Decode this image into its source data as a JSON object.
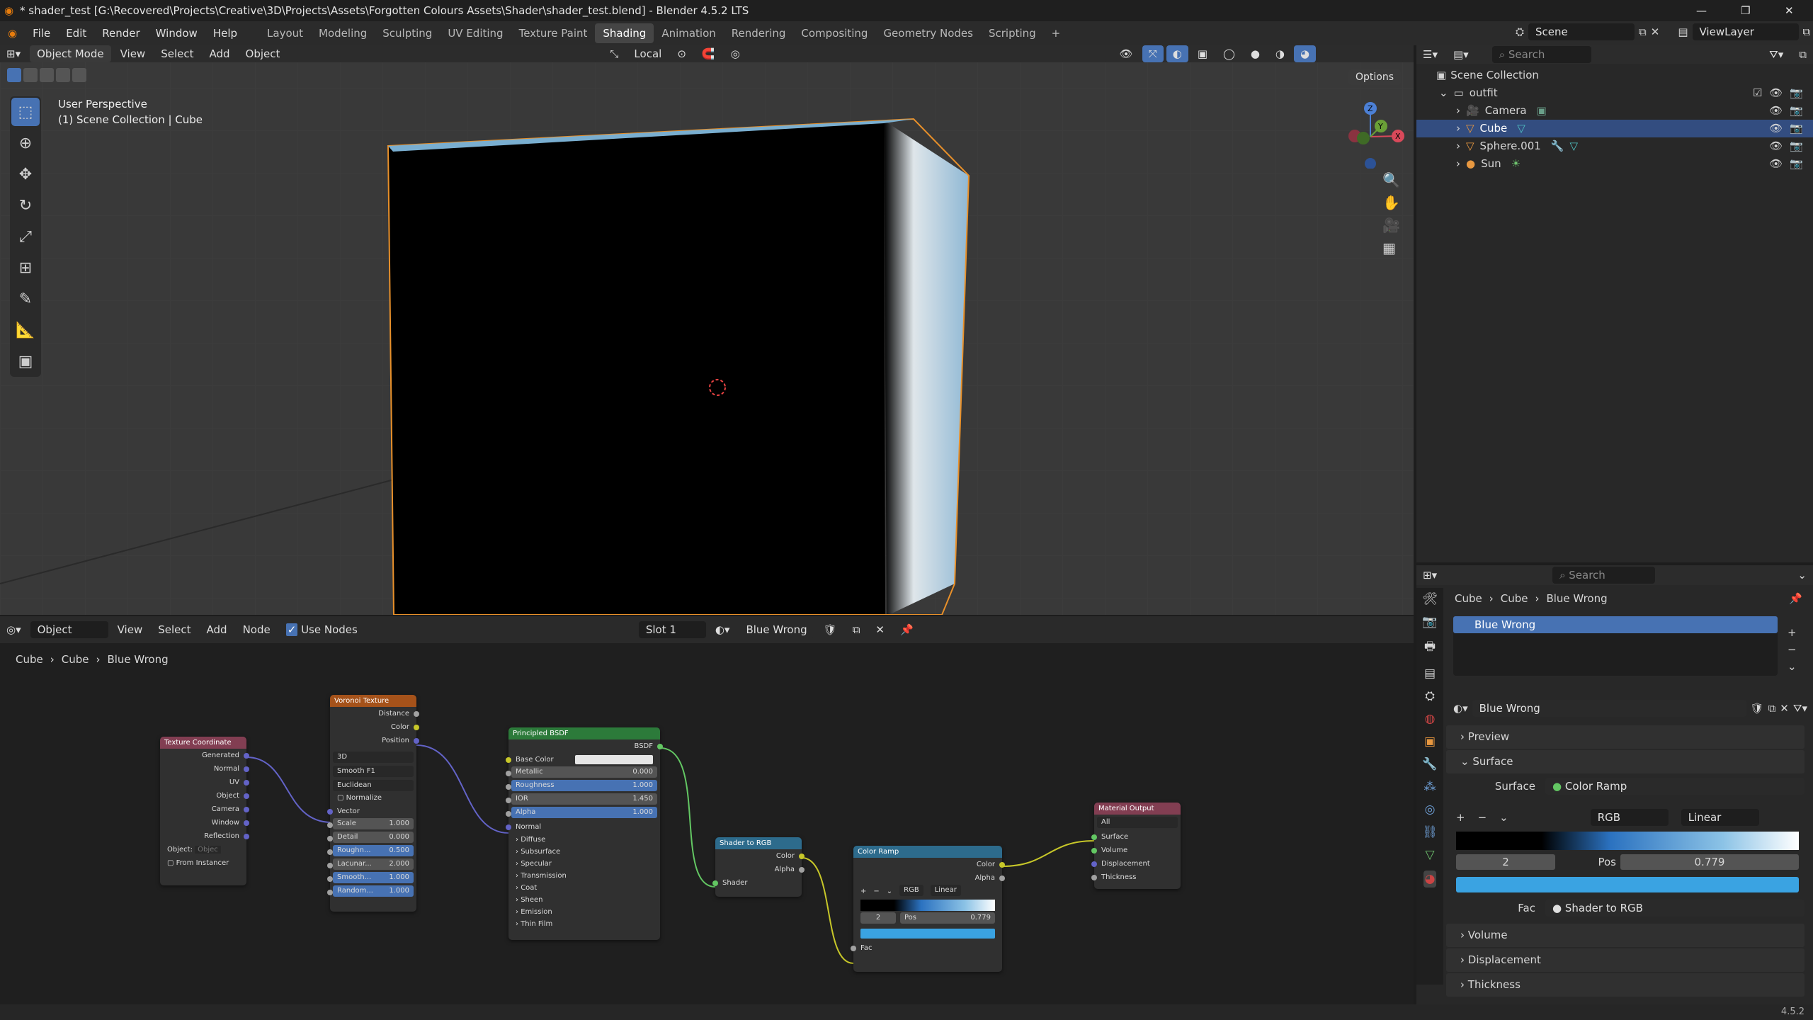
{
  "window": {
    "title": "* shader_test [G:\\Recovered\\Projects\\Creative\\3D\\Projects\\Assets\\Forgotten Colours Assets\\Shader\\shader_test.blend] - Blender 4.5.2 LTS"
  },
  "menu": {
    "items": [
      "File",
      "Edit",
      "Render",
      "Window",
      "Help"
    ]
  },
  "workspaces": [
    "Layout",
    "Modeling",
    "Sculpting",
    "UV Editing",
    "Texture Paint",
    "Shading",
    "Animation",
    "Rendering",
    "Compositing",
    "Geometry Nodes",
    "Scripting"
  ],
  "active_workspace": "Shading",
  "scene": {
    "name": "Scene",
    "view_layer": "ViewLayer"
  },
  "viewport": {
    "mode": "Object Mode",
    "menus": [
      "View",
      "Select",
      "Add",
      "Object"
    ],
    "transform": "Local",
    "options": "Options",
    "overlay_title": "User Perspective",
    "overlay_sub": "(1) Scene Collection | Cube"
  },
  "outliner": {
    "search": "Search",
    "root": "Scene Collection",
    "collection": "outfit",
    "items": [
      "Camera",
      "Cube",
      "Sphere.001",
      "Sun"
    ],
    "selected": "Cube"
  },
  "node_editor": {
    "type": "Object",
    "menus": [
      "View",
      "Select",
      "Add",
      "Node"
    ],
    "use_nodes": "Use Nodes",
    "slot": "Slot 1",
    "material": "Blue Wrong",
    "breadcrumb": [
      "Cube",
      "Cube",
      "Blue Wrong"
    ]
  },
  "nodes": {
    "texcoord": {
      "title": "Texture Coordinate",
      "outputs": [
        "Generated",
        "Normal",
        "UV",
        "Object",
        "Camera",
        "Window",
        "Reflection"
      ],
      "object_label": "Object:",
      "object_placeholder": "Objec",
      "from_instancer": "From Instancer"
    },
    "voronoi": {
      "title": "Voronoi Texture",
      "outputs": [
        "Distance",
        "Color",
        "Position"
      ],
      "dim": "3D",
      "feature": "Smooth F1",
      "metric": "Euclidean",
      "normalize": "Normalize",
      "vector": "Vector",
      "fields": [
        {
          "l": "Scale",
          "v": "1.000"
        },
        {
          "l": "Detail",
          "v": "0.000"
        },
        {
          "l": "Roughn...",
          "v": "0.500"
        },
        {
          "l": "Lacunar...",
          "v": "2.000"
        },
        {
          "l": "Smooth...",
          "v": "1.000"
        },
        {
          "l": "Random...",
          "v": "1.000"
        }
      ]
    },
    "bsdf": {
      "title": "Principled BSDF",
      "out": "BSDF",
      "base_color": "Base Color",
      "fields": [
        {
          "l": "Metallic",
          "v": "0.000"
        },
        {
          "l": "Roughness",
          "v": "1.000"
        },
        {
          "l": "IOR",
          "v": "1.450"
        },
        {
          "l": "Alpha",
          "v": "1.000"
        }
      ],
      "normal": "Normal",
      "panels": [
        "Diffuse",
        "Subsurface",
        "Specular",
        "Transmission",
        "Coat",
        "Sheen",
        "Emission",
        "Thin Film"
      ]
    },
    "s2rgb": {
      "title": "Shader to RGB",
      "outputs": [
        "Color",
        "Alpha"
      ],
      "input": "Shader"
    },
    "ramp": {
      "title": "Color Ramp",
      "outputs": [
        "Color",
        "Alpha"
      ],
      "mode": "RGB",
      "interp": "Linear",
      "index": "2",
      "pos_label": "Pos",
      "pos": "0.779",
      "input": "Fac"
    },
    "output": {
      "title": "Material Output",
      "target": "All",
      "inputs": [
        "Surface",
        "Volume",
        "Displacement",
        "Thickness"
      ]
    }
  },
  "properties": {
    "search": "Search",
    "breadcrumb": [
      "Cube",
      "Cube",
      "Blue Wrong"
    ],
    "slot": "Blue Wrong",
    "material": "Blue Wrong",
    "sections": {
      "preview": "Preview",
      "surface": "Surface",
      "volume": "Volume",
      "displacement": "Displacement",
      "thickness": "Thickness"
    },
    "surface_label": "Surface",
    "surface_value": "Color Ramp",
    "ramp_mode": "RGB",
    "ramp_interp": "Linear",
    "index": "2",
    "pos_label": "Pos",
    "pos": "0.779",
    "fac_label": "Fac",
    "fac_value": "Shader to RGB"
  },
  "status": {
    "version": "4.5.2"
  }
}
